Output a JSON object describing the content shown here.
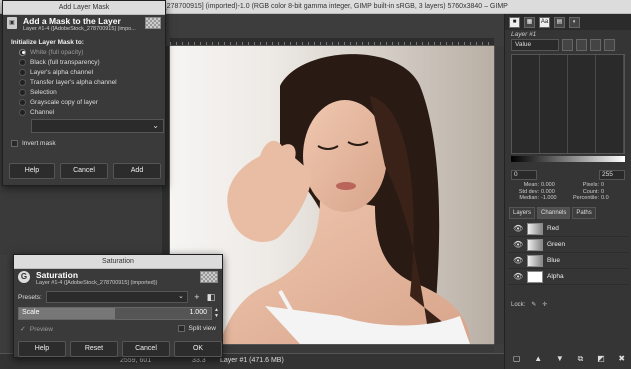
{
  "window": {
    "title": "[AdobeStock_278700915] (imported)-1.0 (RGB color 8-bit gamma integer, GIMP built-in sRGB, 3 layers) 5760x3840 – GIMP"
  },
  "statusbar": {
    "coords": "2559, 601",
    "zoom": "33.3",
    "info": "Layer #1 (471.6 MB)"
  },
  "dock": {
    "tab_icons": [
      "brush-icon",
      "pattern-icon",
      "font-icon",
      "histogram-icon",
      "device-icon"
    ],
    "tab_glyphs": [
      "■",
      "▦",
      "Aa",
      "▤",
      "◐"
    ],
    "layer_label": "Layer #1",
    "histogram": {
      "channel": "Value",
      "range_min": "0",
      "range_max": "255",
      "stats": [
        {
          "k1": "Mean:",
          "v1": "0.000",
          "k2": "Pixels:",
          "v2": "0"
        },
        {
          "k1": "Std dev:",
          "v1": "0.000",
          "k2": "Count:",
          "v2": "0"
        },
        {
          "k1": "Median:",
          "v1": "-1.000",
          "k2": "Percentile:",
          "v2": "0.0"
        }
      ]
    },
    "tabs": [
      "Layers",
      "Channels",
      "Paths"
    ],
    "channels": [
      {
        "name": "Red"
      },
      {
        "name": "Green"
      },
      {
        "name": "Blue"
      },
      {
        "name": "Alpha"
      }
    ],
    "lock_label": "Lock:"
  },
  "mask_dialog": {
    "window_title": "Add Layer Mask",
    "title": "Add a Mask to the Layer",
    "subtitle": "Layer #1-4 ([AdobeStock_278700915] (impo...",
    "init_label": "Initialize Layer Mask to:",
    "options": [
      "White (full opacity)",
      "Black (full transparency)",
      "Layer's alpha channel",
      "Transfer layer's alpha channel",
      "Selection",
      "Grayscale copy of layer",
      "Channel"
    ],
    "selected_index": 0,
    "invert_label": "Invert mask",
    "buttons": {
      "help": "Help",
      "cancel": "Cancel",
      "add": "Add"
    }
  },
  "saturation_dialog": {
    "window_title": "Saturation",
    "title": "Saturation",
    "subtitle": "Layer #1-4 ([AdobeStock_278700915] (imported))",
    "presets_label": "Presets:",
    "scale_label": "Scale",
    "scale_value": "1.000",
    "scale_fraction": 0.5,
    "preview_label": "Preview",
    "split_label": "Split view",
    "buttons": {
      "help": "Help",
      "reset": "Reset",
      "cancel": "Cancel",
      "ok": "OK"
    }
  }
}
